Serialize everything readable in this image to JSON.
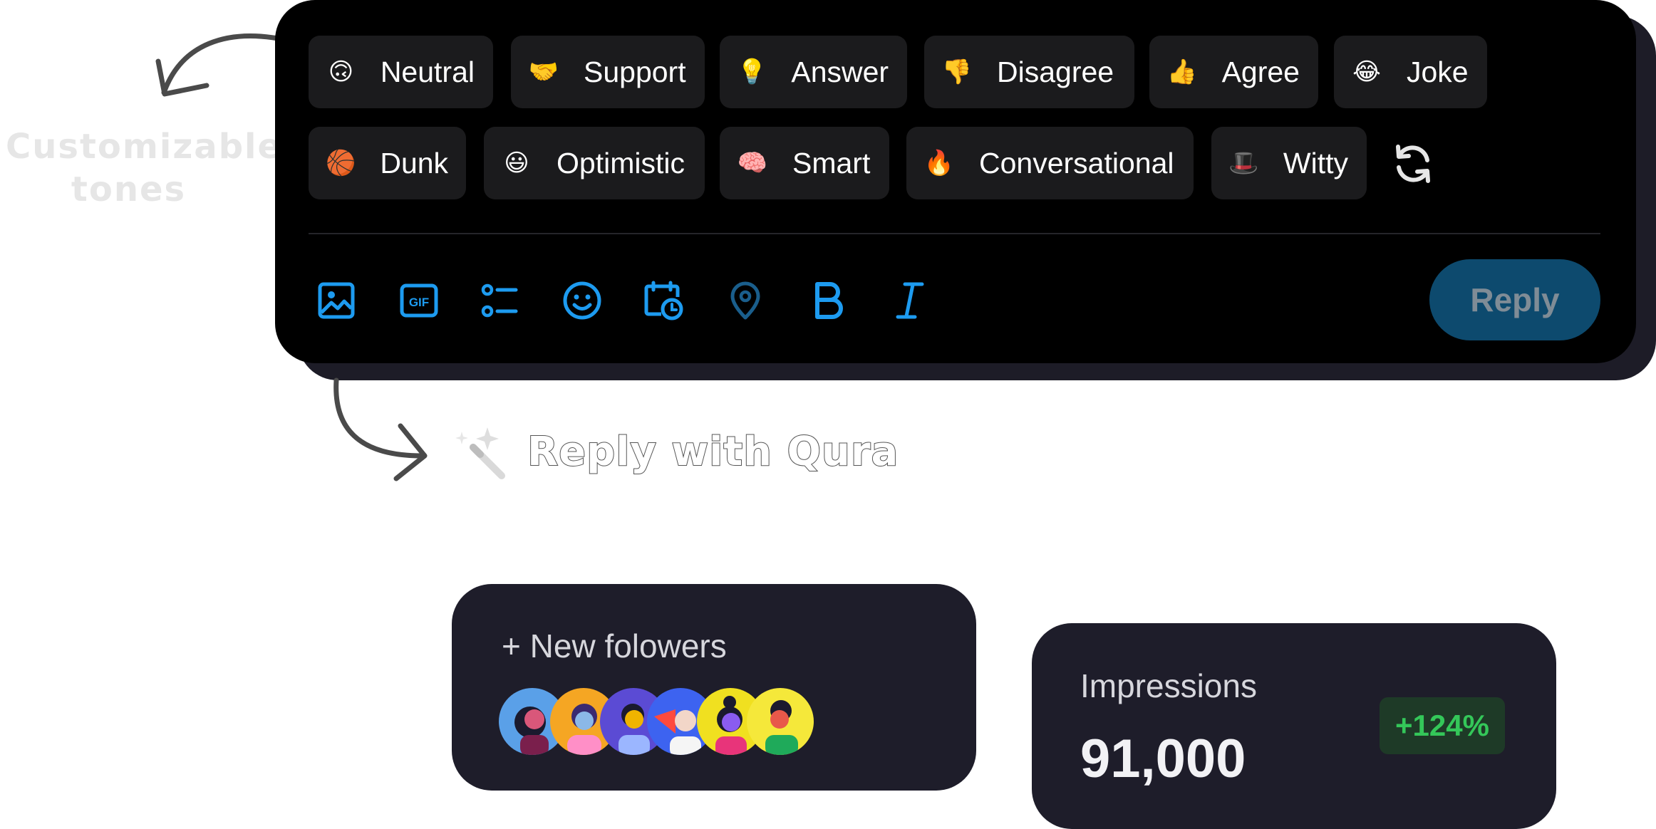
{
  "annotations": {
    "tones_line1": "Customizable",
    "tones_line2": "tones",
    "reply_with": "Reply with Qura"
  },
  "tones": [
    {
      "emoji": "🙃",
      "label": "Neutral"
    },
    {
      "emoji": "🤝",
      "label": "Support"
    },
    {
      "emoji": "💡",
      "label": "Answer"
    },
    {
      "emoji": "👎",
      "label": "Disagree"
    },
    {
      "emoji": "👍",
      "label": "Agree"
    },
    {
      "emoji": "😂",
      "label": "Joke"
    },
    {
      "emoji": "🏀",
      "label": "Dunk"
    },
    {
      "emoji": "😃",
      "label": "Optimistic"
    },
    {
      "emoji": "🧠",
      "label": "Smart"
    },
    {
      "emoji": "🔥",
      "label": "Conversational"
    },
    {
      "emoji": "🎩",
      "label": "Witty"
    }
  ],
  "toolbar": {
    "gif_label": "GIF",
    "icons": [
      "image-icon",
      "gif-icon",
      "poll-icon",
      "emoji-icon",
      "schedule-icon",
      "location-icon",
      "bold-icon",
      "italic-icon"
    ],
    "reply_label": "Reply",
    "accent": "#1d9bf0"
  },
  "followers": {
    "label": "+ New folowers"
  },
  "impressions": {
    "label": "Impressions",
    "value": "91,000",
    "change": "+124%",
    "change_color": "#34c759"
  }
}
